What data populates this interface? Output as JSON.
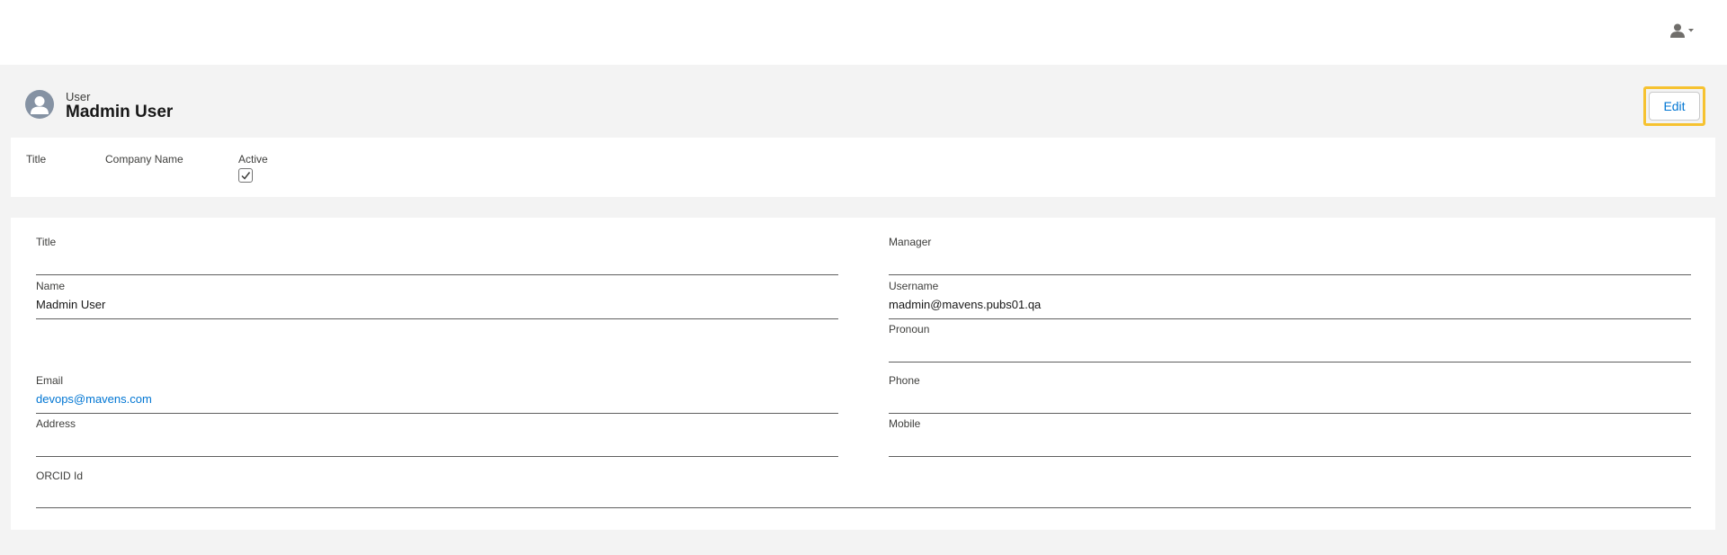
{
  "header": {
    "entity_label": "User",
    "record_name": "Madmin User",
    "edit_label": "Edit"
  },
  "highlights": {
    "title_label": "Title",
    "company_label": "Company Name",
    "active_label": "Active",
    "active_checked": true
  },
  "details": {
    "title": {
      "label": "Title",
      "value": ""
    },
    "manager": {
      "label": "Manager",
      "value": ""
    },
    "name": {
      "label": "Name",
      "value": "Madmin User"
    },
    "username": {
      "label": "Username",
      "value": "madmin@mavens.pubs01.qa"
    },
    "pronoun": {
      "label": "Pronoun",
      "value": ""
    },
    "email": {
      "label": "Email",
      "value": "devops@mavens.com"
    },
    "phone": {
      "label": "Phone",
      "value": ""
    },
    "address": {
      "label": "Address",
      "value": ""
    },
    "mobile": {
      "label": "Mobile",
      "value": ""
    },
    "orcid": {
      "label": "ORCID Id",
      "value": ""
    }
  },
  "icons": {
    "user_menu": "user-icon",
    "avatar": "user-avatar-icon",
    "checkbox": "checkmark-icon"
  },
  "colors": {
    "link": "#0176d3",
    "highlight": "#f6c230",
    "avatar_bg": "#8592a3"
  }
}
